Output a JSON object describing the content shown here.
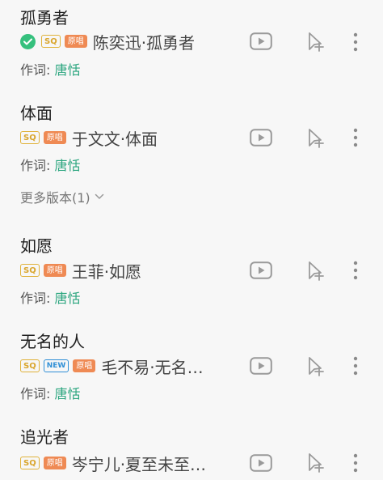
{
  "songs": [
    {
      "title": "孤勇者",
      "verified": true,
      "badges": {
        "sq": "SQ",
        "new": null,
        "original": "原唱"
      },
      "artist_title": "陈奕迅·孤勇者",
      "lyricist_label": "作词: ",
      "lyricist": "唐恬",
      "more_versions": null
    },
    {
      "title": "体面",
      "verified": false,
      "badges": {
        "sq": "SQ",
        "new": null,
        "original": "原唱"
      },
      "artist_title": "于文文·体面",
      "lyricist_label": "作词: ",
      "lyricist": "唐恬",
      "more_versions": "更多版本(1)"
    },
    {
      "title": "如愿",
      "verified": false,
      "badges": {
        "sq": "SQ",
        "new": null,
        "original": "原唱"
      },
      "artist_title": "王菲·如愿",
      "lyricist_label": "作词: ",
      "lyricist": "唐恬",
      "more_versions": null
    },
    {
      "title": "无名的人",
      "verified": false,
      "badges": {
        "sq": "SQ",
        "new": "NEW",
        "original": "原唱"
      },
      "artist_title": "毛不易·无名…",
      "lyricist_label": "作词: ",
      "lyricist": "唐恬",
      "more_versions": null
    },
    {
      "title": "追光者",
      "verified": false,
      "badges": {
        "sq": "SQ",
        "new": null,
        "original": "原唱"
      },
      "artist_title": "岑宁儿·夏至未至…",
      "lyricist_label": null,
      "lyricist": null,
      "more_versions": null
    }
  ],
  "icons": {
    "verified": "check-circle-icon",
    "play": "play-video-icon",
    "add": "add-to-playlist-icon",
    "more": "more-vertical-icon",
    "chevron": "chevron-down-icon"
  },
  "colors": {
    "accent_green": "#2aa57e",
    "check_green": "#35c07d",
    "sq_gold": "#d9a52c",
    "original_orange": "#ef8a54",
    "new_blue": "#2f8fd6",
    "icon_gray": "#9a9a9a"
  }
}
